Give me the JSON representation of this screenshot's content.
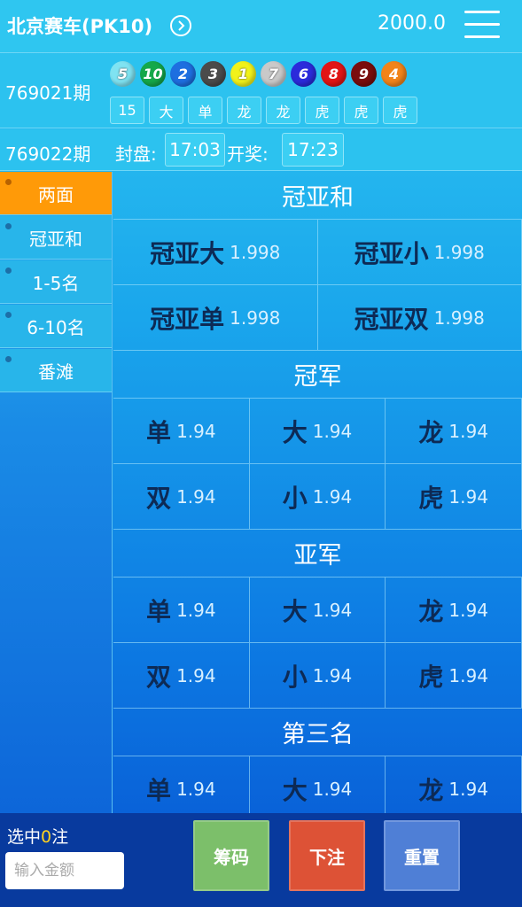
{
  "header": {
    "game_title": "北京赛车(PK10)",
    "balance": "2000.0"
  },
  "last_draw": {
    "issue": "769021期",
    "balls": [
      {
        "num": "5",
        "color": "#7fe3f2"
      },
      {
        "num": "10",
        "color": "#15a84a"
      },
      {
        "num": "2",
        "color": "#1e6fe0"
      },
      {
        "num": "3",
        "color": "#4b4b4b"
      },
      {
        "num": "1",
        "color": "#f2f21a"
      },
      {
        "num": "7",
        "color": "#c9c9c9"
      },
      {
        "num": "6",
        "color": "#2b2bdb"
      },
      {
        "num": "8",
        "color": "#e21515"
      },
      {
        "num": "9",
        "color": "#7a0d0d"
      },
      {
        "num": "4",
        "color": "#f2841a"
      }
    ],
    "tags": [
      "15",
      "大",
      "单",
      "龙",
      "龙",
      "虎",
      "虎",
      "虎"
    ]
  },
  "next_draw": {
    "issue": "769022期",
    "close_label": "封盘:",
    "close_time": "17:03",
    "open_label": "开奖:",
    "open_time": "17:23"
  },
  "sidebar": {
    "items": [
      {
        "label": "两面",
        "active": true
      },
      {
        "label": "冠亚和",
        "active": false
      },
      {
        "label": "1-5名",
        "active": false
      },
      {
        "label": "6-10名",
        "active": false
      },
      {
        "label": "番滩",
        "active": false
      }
    ]
  },
  "sections": [
    {
      "title": "冠亚和",
      "cols": 2,
      "cells": [
        {
          "name": "冠亚大",
          "odds": "1.998"
        },
        {
          "name": "冠亚小",
          "odds": "1.998"
        },
        {
          "name": "冠亚单",
          "odds": "1.998"
        },
        {
          "name": "冠亚双",
          "odds": "1.998"
        }
      ]
    },
    {
      "title": "冠军",
      "cols": 3,
      "cells": [
        {
          "name": "单",
          "odds": "1.94"
        },
        {
          "name": "大",
          "odds": "1.94"
        },
        {
          "name": "龙",
          "odds": "1.94"
        },
        {
          "name": "双",
          "odds": "1.94"
        },
        {
          "name": "小",
          "odds": "1.94"
        },
        {
          "name": "虎",
          "odds": "1.94"
        }
      ]
    },
    {
      "title": "亚军",
      "cols": 3,
      "cells": [
        {
          "name": "单",
          "odds": "1.94"
        },
        {
          "name": "大",
          "odds": "1.94"
        },
        {
          "name": "龙",
          "odds": "1.94"
        },
        {
          "name": "双",
          "odds": "1.94"
        },
        {
          "name": "小",
          "odds": "1.94"
        },
        {
          "name": "虎",
          "odds": "1.94"
        }
      ]
    },
    {
      "title": "第三名",
      "cols": 3,
      "cells": [
        {
          "name": "单",
          "odds": "1.94"
        },
        {
          "name": "大",
          "odds": "1.94"
        },
        {
          "name": "龙",
          "odds": "1.94"
        }
      ]
    }
  ],
  "footer": {
    "selected_prefix": "选中",
    "selected_count": "0",
    "selected_suffix": "注",
    "amount_placeholder": "输入金额",
    "chips_label": "筹码",
    "bet_label": "下注",
    "reset_label": "重置",
    "chips_color": "#7cbf6a",
    "bet_color": "#dd5236",
    "reset_color": "#4f7fd6"
  },
  "icons": {
    "title_chevron": "chevron-right-circle-icon",
    "menu": "hamburger-menu-icon"
  }
}
